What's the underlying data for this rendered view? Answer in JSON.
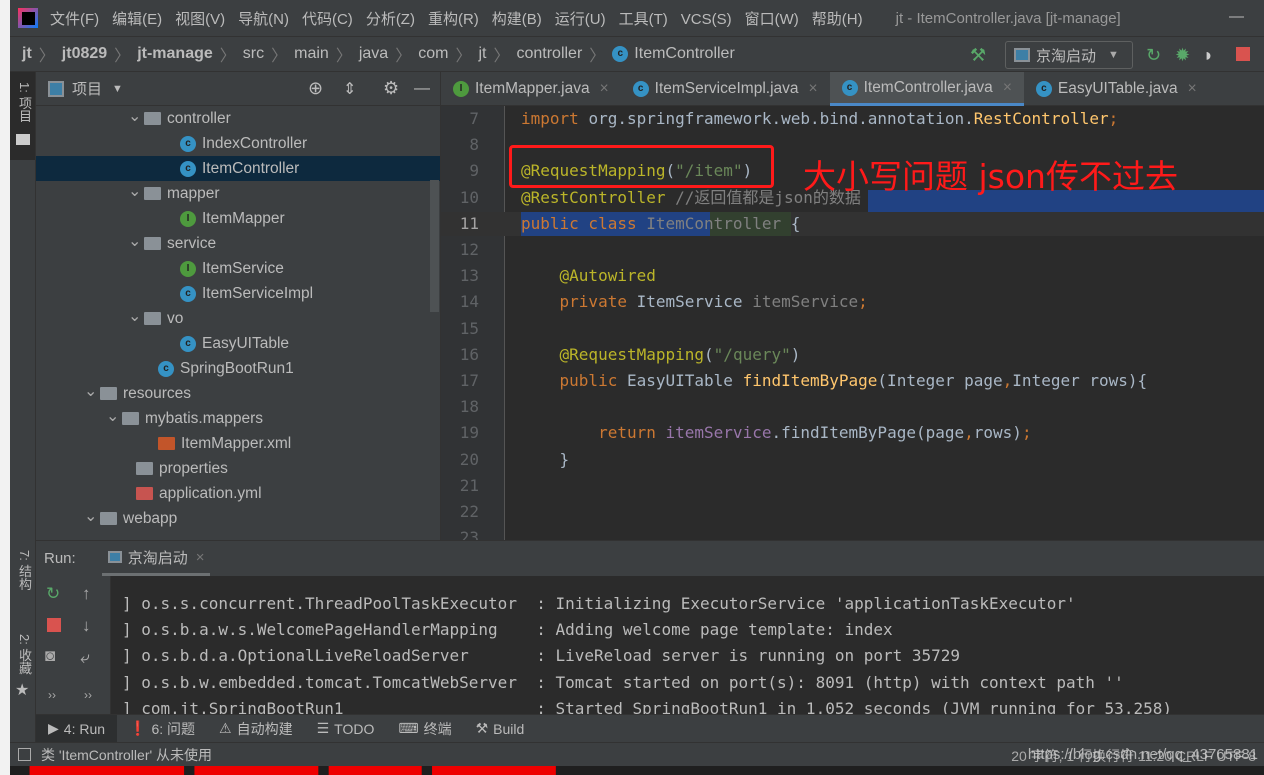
{
  "app": {
    "title": "jt - ItemController.java [jt-manage]",
    "logo": "IJ",
    "menu": [
      "文件(F)",
      "编辑(E)",
      "视图(V)",
      "导航(N)",
      "代码(C)",
      "分析(Z)",
      "重构(R)",
      "构建(B)",
      "运行(U)",
      "工具(T)",
      "VCS(S)",
      "窗口(W)",
      "帮助(H)"
    ]
  },
  "breadcrumb": [
    "jt",
    "jt0829",
    "jt-manage",
    "src",
    "main",
    "java",
    "com",
    "jt",
    "controller",
    "ItemController"
  ],
  "toolbar": {
    "run_config": "京淘启动",
    "icons": [
      "hammer-icon",
      "rerun-icon",
      "debug-icon",
      "coverage-icon",
      "stop-icon"
    ]
  },
  "left_strip": {
    "project": "1: 项目",
    "structure": "7: 结构",
    "favorites": "2: 收藏"
  },
  "project": {
    "title": "项目",
    "tree": [
      {
        "label": "controller",
        "type": "package",
        "indent": 4,
        "open": true
      },
      {
        "label": "IndexController",
        "type": "class",
        "indent": 5
      },
      {
        "label": "ItemController",
        "type": "class",
        "indent": 5,
        "selected": true
      },
      {
        "label": "mapper",
        "type": "package",
        "indent": 4,
        "open": true
      },
      {
        "label": "ItemMapper",
        "type": "interface",
        "indent": 5
      },
      {
        "label": "service",
        "type": "package",
        "indent": 4,
        "open": true
      },
      {
        "label": "ItemService",
        "type": "interface",
        "indent": 5
      },
      {
        "label": "ItemServiceImpl",
        "type": "class",
        "indent": 5
      },
      {
        "label": "vo",
        "type": "package",
        "indent": 4,
        "open": true
      },
      {
        "label": "EasyUITable",
        "type": "class",
        "indent": 5
      },
      {
        "label": "SpringBootRun1",
        "type": "runclass",
        "indent": 4
      },
      {
        "label": "resources",
        "type": "resfolder",
        "indent": 2,
        "open": true
      },
      {
        "label": "mybatis.mappers",
        "type": "folder",
        "indent": 3,
        "open": true
      },
      {
        "label": "ItemMapper.xml",
        "type": "xml",
        "indent": 4
      },
      {
        "label": "properties",
        "type": "folder",
        "indent": 3
      },
      {
        "label": "application.yml",
        "type": "yml",
        "indent": 3
      },
      {
        "label": "webapp",
        "type": "folder",
        "indent": 2,
        "open": true
      }
    ]
  },
  "editor": {
    "tabs": [
      {
        "label": "ItemMapper.java",
        "type": "interface"
      },
      {
        "label": "ItemServiceImpl.java",
        "type": "class"
      },
      {
        "label": "ItemController.java",
        "type": "class",
        "active": true
      },
      {
        "label": "EasyUITable.java",
        "type": "class"
      }
    ],
    "lines": [
      {
        "n": "7",
        "html": [
          [
            "kw",
            "import "
          ],
          [
            "",
            "org.springframework.web.bind.annotation."
          ],
          [
            "fn",
            "RestController"
          ],
          [
            "kw",
            ";"
          ]
        ]
      },
      {
        "n": "8",
        "html": []
      },
      {
        "n": "9",
        "html": [
          [
            "an",
            "@RequestMapping"
          ],
          [
            "",
            "("
          ],
          [
            "st",
            "\"/item\""
          ],
          [
            "",
            ")"
          ]
        ]
      },
      {
        "n": "10",
        "html": [
          [
            "an",
            "@RestController"
          ],
          [
            "cm",
            " //返回值都是json的数据"
          ]
        ]
      },
      {
        "n": "11",
        "html": [
          [
            "kw",
            "public class "
          ],
          [
            "gray",
            "ItemController"
          ],
          [
            "",
            " {"
          ]
        ]
      },
      {
        "n": "12",
        "html": []
      },
      {
        "n": "13",
        "html": [
          [
            "",
            "    "
          ],
          [
            "an",
            "@Autowired"
          ]
        ]
      },
      {
        "n": "14",
        "html": [
          [
            "",
            "    "
          ],
          [
            "kw",
            "private "
          ],
          [
            "",
            "ItemService "
          ],
          [
            "gray",
            "itemService"
          ],
          [
            "kw",
            ";"
          ]
        ]
      },
      {
        "n": "15",
        "html": []
      },
      {
        "n": "16",
        "html": [
          [
            "",
            "    "
          ],
          [
            "an",
            "@RequestMapping"
          ],
          [
            "",
            "("
          ],
          [
            "st",
            "\"/query\""
          ],
          [
            "",
            ")"
          ]
        ]
      },
      {
        "n": "17",
        "html": [
          [
            "",
            "    "
          ],
          [
            "kw",
            "public "
          ],
          [
            "",
            "EasyUITable "
          ],
          [
            "fn",
            "findItemByPage"
          ],
          [
            "",
            "(Integer page"
          ],
          [
            "kw",
            ","
          ],
          [
            "",
            "Integer rows){"
          ]
        ]
      },
      {
        "n": "18",
        "html": []
      },
      {
        "n": "19",
        "html": [
          [
            "",
            "        "
          ],
          [
            "kw",
            "return "
          ],
          [
            "fld",
            "itemService"
          ],
          [
            "",
            ".findItemByPage(page"
          ],
          [
            "kw",
            ","
          ],
          [
            "",
            "rows)"
          ],
          [
            "kw",
            ";"
          ]
        ]
      },
      {
        "n": "20",
        "html": [
          [
            "",
            "    }"
          ]
        ]
      },
      {
        "n": "21",
        "html": []
      },
      {
        "n": "22",
        "html": []
      },
      {
        "n": "23",
        "html": []
      }
    ],
    "annotation": "大小写问题 json传不过去"
  },
  "run": {
    "label": "Run:",
    "tab": "京淘启动",
    "console": [
      "] o.s.s.concurrent.ThreadPoolTaskExecutor  : Initializing ExecutorService 'applicationTaskExecutor'",
      "] o.s.b.a.w.s.WelcomePageHandlerMapping    : Adding welcome page template: index",
      "] o.s.b.d.a.OptionalLiveReloadServer       : LiveReload server is running on port 35729",
      "] o.s.b.w.embedded.tomcat.TomcatWebServer  : Tomcat started on port(s): 8091 (http) with context path ''",
      "] com.jt.SpringBootRun1                    : Started SpringBootRun1 in 1.052 seconds (JVM running for 53.258)"
    ]
  },
  "bottom_tabs": [
    "4: Run",
    "6: 问题",
    "自动构建",
    "TODO",
    "终端",
    "Build"
  ],
  "status": {
    "message": "类 'ItemController' 从未使用",
    "right": "20 字符, 1 行换行符   11:20   CRLF   UTF-8",
    "watermark": "https://blog.csdn.net/qq_43765881"
  },
  "colors": {
    "accent": "#4a88c7",
    "annotation": "#ff1a1a",
    "selection": "#0d293e"
  }
}
